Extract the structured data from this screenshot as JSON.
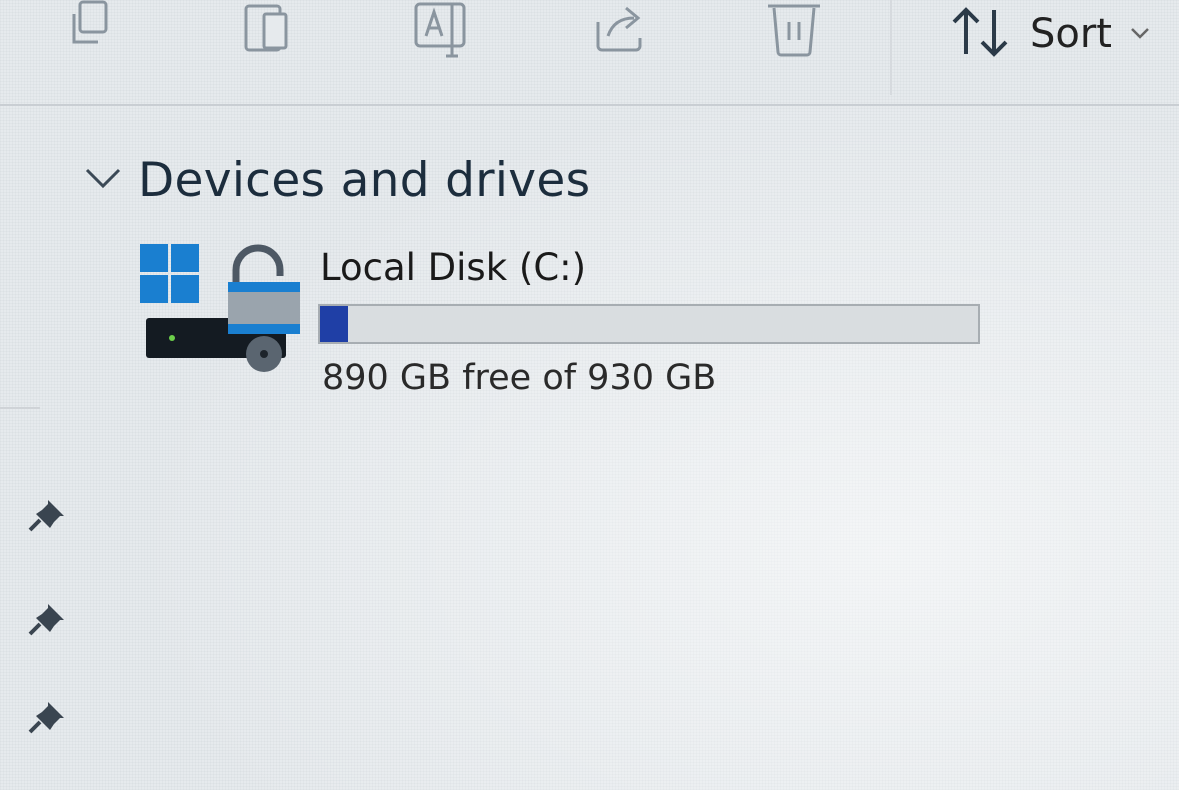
{
  "toolbar": {
    "icons": [
      "copy-icon",
      "paste-icon",
      "rename-icon",
      "share-icon",
      "delete-icon"
    ],
    "sort_label": "Sort",
    "sort_icon": "sort-arrows-icon",
    "chevron_icon": "chevron-down-icon"
  },
  "section": {
    "title": "Devices and drives",
    "chevron_icon": "chevron-down-icon"
  },
  "drive": {
    "name": "Local Disk (C:)",
    "free_text": "890 GB free of 930 GB",
    "used_fraction": 0.043,
    "icon": "locked-windows-drive-icon"
  },
  "left_pane": {
    "pin_icons": [
      "pin-icon",
      "pin-icon",
      "pin-icon"
    ]
  },
  "colors": {
    "accent": "#1f3fa6",
    "windows_blue": "#1a7fd0",
    "background": "#e6eaed"
  }
}
